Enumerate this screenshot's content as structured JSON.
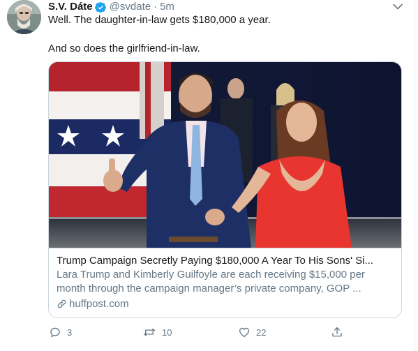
{
  "tweet": {
    "display_name": "S.V. Dáte",
    "handle": "@svdate",
    "separator": "·",
    "time": "5m",
    "text_line1": "Well. The daughter-in-law gets $180,000 a year.",
    "text_line2": "And so does the girlfriend-in-law."
  },
  "card": {
    "title": "Trump Campaign Secretly Paying $180,000 A Year To His Sons' Si...",
    "desc_line1": "Lara Trump and Kimberly Guilfoyle are each receiving $15,000 per",
    "desc_line2": "month through the campaign manager’s private company, GOP ...",
    "domain": "huffpost.com"
  },
  "actions": {
    "replies": "3",
    "retweets": "10",
    "likes": "22"
  },
  "icons": {
    "verified": "verified-badge-icon",
    "caret": "chevron-down-icon",
    "link": "link-icon",
    "reply": "reply-icon",
    "retweet": "retweet-icon",
    "like": "heart-icon",
    "share": "share-icon"
  },
  "colors": {
    "accent": "#1da1f2",
    "text_primary": "#14171a",
    "text_secondary": "#657786",
    "border": "#ccd6dd"
  }
}
